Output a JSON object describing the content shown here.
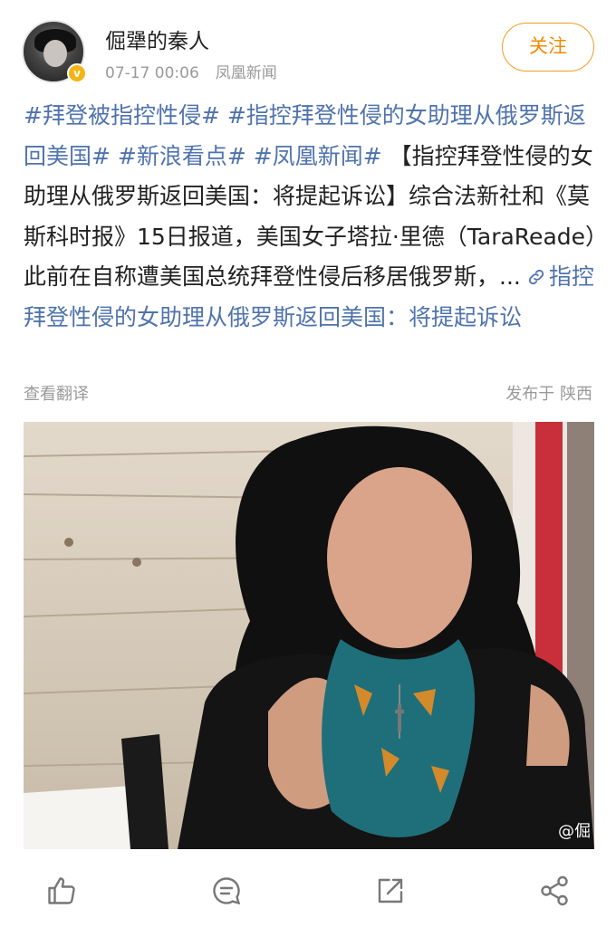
{
  "author": {
    "name": "倔犟的秦人",
    "verified_badge": "v",
    "avatar_icon": "avatar-photo"
  },
  "post": {
    "time": "07-17 00:06",
    "source": "凤凰新闻",
    "follow_label": "关注",
    "tags": [
      "#拜登被指控性侵#",
      "#指控拜登性侵的女助理从俄罗斯返回美国#",
      "#新浪看点#",
      "#凤凰新闻#"
    ],
    "body": "【指控拜登性侵的女助理从俄罗斯返回美国：将提起诉讼】综合法新社和《莫斯科时报》15日报道，美国女子塔拉·里德（TaraReade）此前在自称遭美国总统拜登性侵后移居俄罗斯，...",
    "link_text": "指控拜登性侵的女助理从俄罗斯返回美国：将提起诉讼",
    "translate_label": "查看翻译",
    "location": "发布于 陕西",
    "image_watermark": "@倔"
  },
  "actions": {
    "like_icon": "thumb-up-icon",
    "comment_icon": "comment-icon",
    "repost_icon": "repost-icon",
    "share_icon": "share-icon"
  },
  "colors": {
    "tag": "#4f73ad",
    "accent": "#f08b00",
    "muted": "#9a9a9a"
  }
}
